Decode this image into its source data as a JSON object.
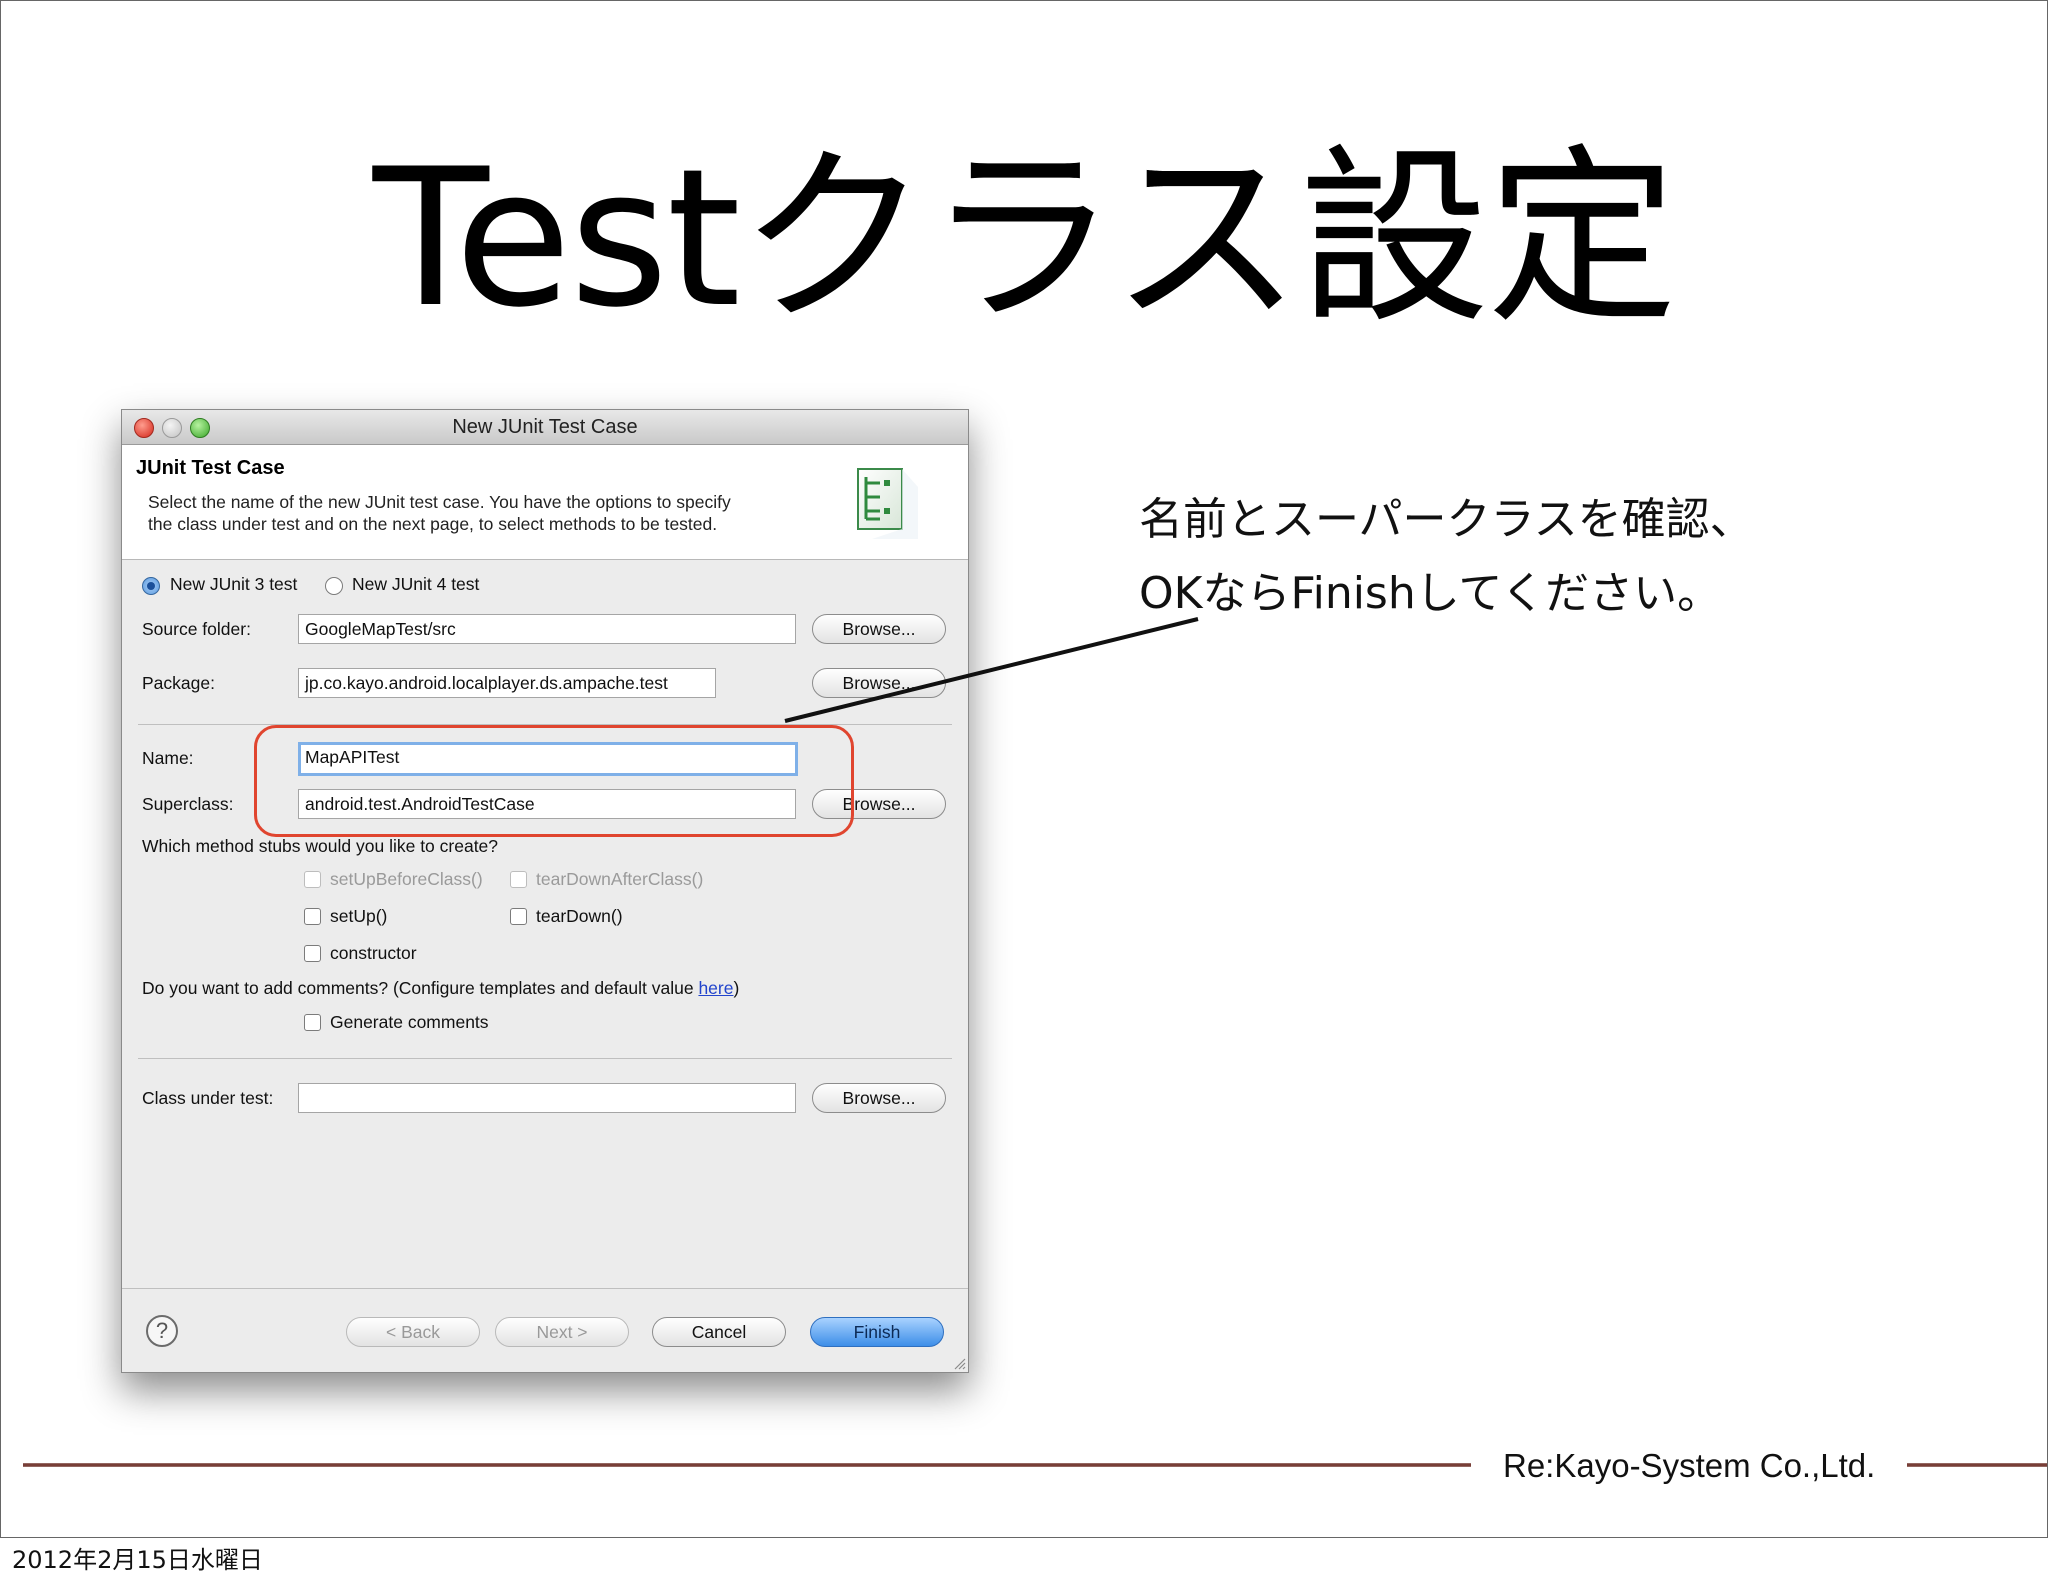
{
  "slide": {
    "title": "Testクラス設定",
    "annotation": [
      "名前とスーパークラスを確認、",
      "OKならFinishしてください。"
    ],
    "company": "Re:Kayo-System Co.,Ltd.",
    "date": "2012年2月15日水曜日"
  },
  "dialog": {
    "window_title": "New JUnit Test Case",
    "header_title": "JUnit Test Case",
    "header_desc": [
      "Select the name of the new JUnit test case. You have the options to specify",
      "the class under test and on the next page, to select methods to be tested."
    ],
    "radio_junit3": "New JUnit 3 test",
    "radio_junit4": "New JUnit 4 test",
    "source_folder_label": "Source folder:",
    "source_folder_value": "GoogleMapTest/src",
    "package_label": "Package:",
    "package_value": "jp.co.kayo.android.localplayer.ds.ampache.test",
    "name_label": "Name:",
    "name_value": "MapAPITest",
    "superclass_label": "Superclass:",
    "superclass_value": "android.test.AndroidTestCase",
    "browse_label": "Browse...",
    "stubs_question": "Which method stubs would you like to create?",
    "stub_setup_before_class": "setUpBeforeClass()",
    "stub_teardown_after_class": "tearDownAfterClass()",
    "stub_setup": "setUp()",
    "stub_teardown": "tearDown()",
    "stub_constructor": "constructor",
    "comments_question": "Do you want to add comments? (Configure templates and default value ",
    "comments_link": "here",
    "comments_close": ")",
    "generate_comments": "Generate comments",
    "class_under_test_label": "Class under test:",
    "class_under_test_value": "",
    "back_label": "< Back",
    "next_label": "Next >",
    "cancel_label": "Cancel",
    "finish_label": "Finish",
    "help_label": "?"
  },
  "colors": {
    "callout": "#e0452f",
    "default_button": "#3d8ee8",
    "link": "#2244cc"
  }
}
